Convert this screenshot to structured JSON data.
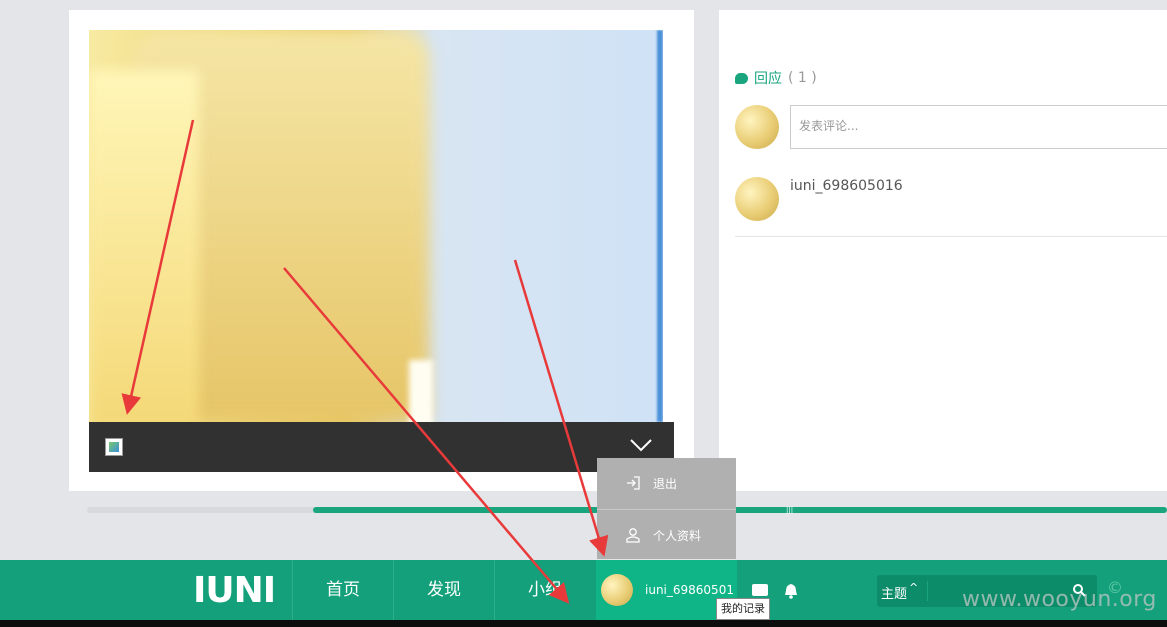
{
  "comments": {
    "reply_label": "回应",
    "reply_count": "( 1 )",
    "input_placeholder": "发表评论...",
    "first_comment_user": "iuni_698605016"
  },
  "user_menu": {
    "logout": "退出",
    "profile": "个人资料"
  },
  "navbar": {
    "logo": "IUNI",
    "home": "首页",
    "discover": "发现",
    "groups": "小组",
    "username": "iuni_69860501",
    "theme_label": "主题",
    "tooltip": "我的记录"
  },
  "watermark": "www.wooyun.org",
  "colors": {
    "accent": "#13a07a",
    "arrow": "#e83a3a"
  },
  "icons": [
    "broken-image-icon",
    "chevron-down-icon",
    "reply-bubble-icon",
    "logout-icon",
    "profile-icon",
    "message-icon",
    "bell-icon",
    "search-icon"
  ]
}
